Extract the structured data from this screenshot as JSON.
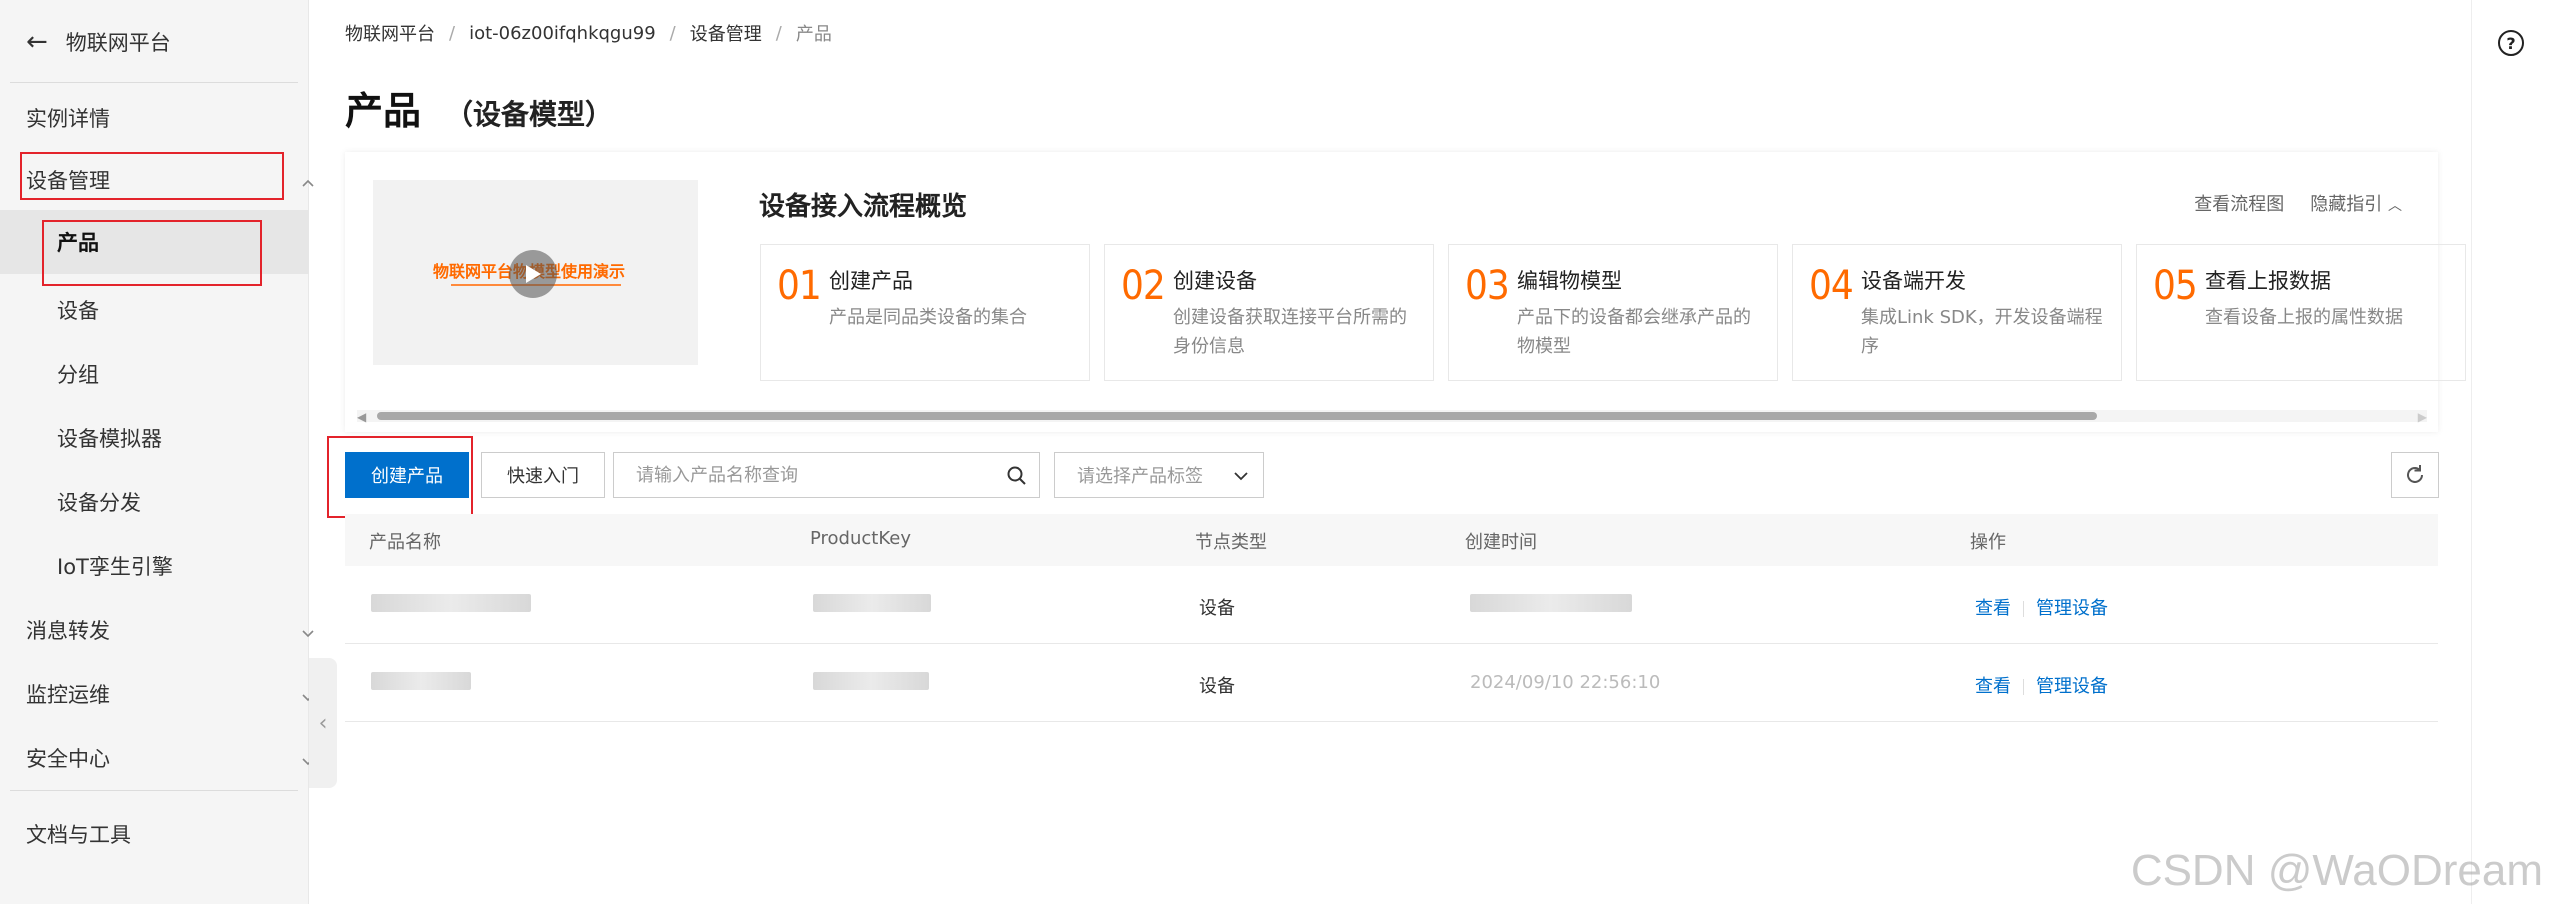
{
  "sidebar": {
    "back_label": "物联网平台",
    "items": [
      {
        "label": "实例详情"
      },
      {
        "label": "设备管理"
      },
      {
        "label": "产品"
      },
      {
        "label": "设备"
      },
      {
        "label": "分组"
      },
      {
        "label": "设备模拟器"
      },
      {
        "label": "设备分发"
      },
      {
        "label": "IoT孪生引擎"
      },
      {
        "label": "消息转发"
      },
      {
        "label": "监控运维"
      },
      {
        "label": "安全中心"
      },
      {
        "label": "文档与工具"
      }
    ]
  },
  "breadcrumb": [
    "物联网平台",
    "iot-06z00ifqhkqgu99",
    "设备管理",
    "产品"
  ],
  "page": {
    "title": "产品",
    "subtitle": "（设备模型）"
  },
  "guide": {
    "video_title": "物联网平台物模型使用演示",
    "title": "设备接入流程概览",
    "link_flow": "查看流程图",
    "link_hide": "隐藏指引",
    "steps": [
      {
        "num": "01",
        "title": "创建产品",
        "desc": "产品是同品类设备的集合"
      },
      {
        "num": "02",
        "title": "创建设备",
        "desc": "创建设备获取连接平台所需的身份信息"
      },
      {
        "num": "03",
        "title": "编辑物模型",
        "desc": "产品下的设备都会继承产品的物模型"
      },
      {
        "num": "04",
        "title": "设备端开发",
        "desc": "集成Link SDK，开发设备端程序"
      },
      {
        "num": "05",
        "title": "查看上报数据",
        "desc": "查看设备上报的属性数据"
      }
    ]
  },
  "toolbar": {
    "create_label": "创建产品",
    "quick_label": "快速入门",
    "search_placeholder": "请输入产品名称查询",
    "tag_placeholder": "请选择产品标签"
  },
  "table": {
    "headers": [
      "产品名称",
      "ProductKey",
      "节点类型",
      "创建时间",
      "操作"
    ],
    "rows": [
      {
        "node_type": "设备",
        "time_visible": "",
        "view": "查看",
        "manage": "管理设备"
      },
      {
        "node_type": "设备",
        "time_visible": "2024/09/10 22:56:10",
        "view": "查看",
        "manage": "管理设备"
      }
    ]
  },
  "watermark": "CSDN @WaODream",
  "colors": {
    "primary": "#0070cc",
    "accent": "#ff6a00",
    "highlight": "#e3232b"
  }
}
